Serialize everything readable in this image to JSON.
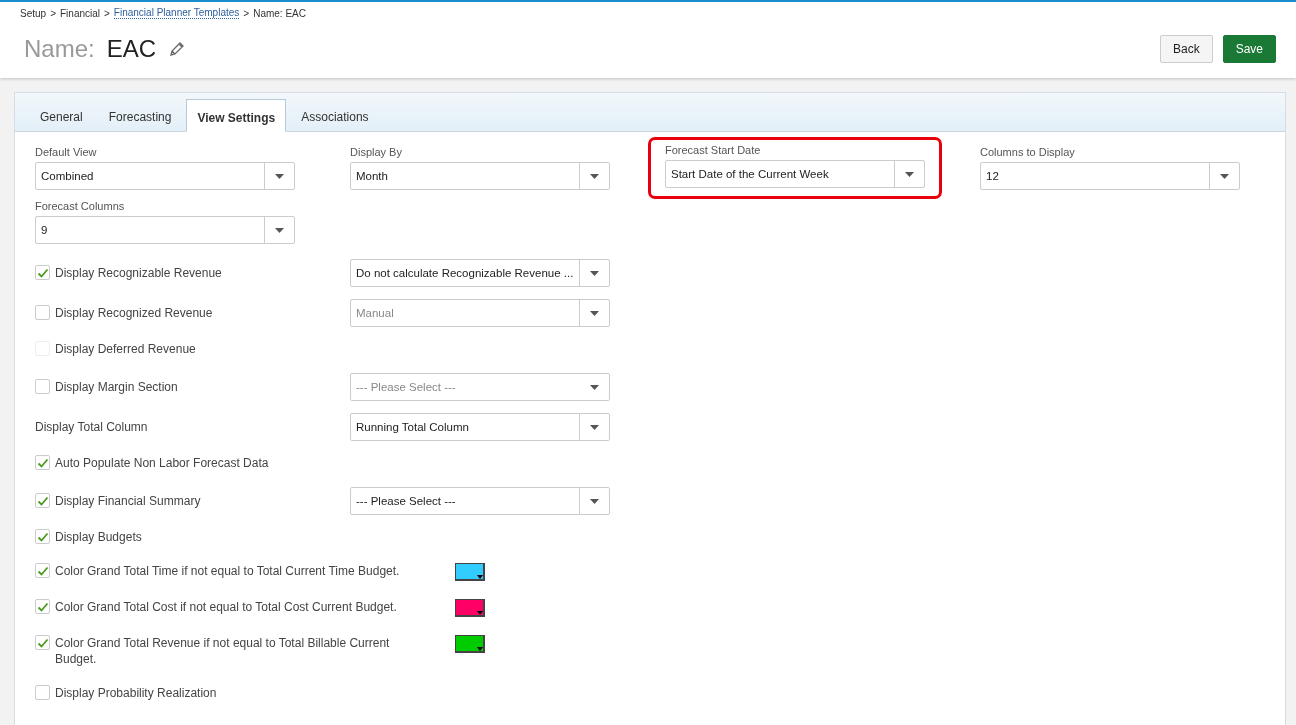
{
  "breadcrumb": [
    {
      "text": "Setup",
      "link": false
    },
    {
      "text": "Financial",
      "link": false
    },
    {
      "text": "Financial Planner Templates",
      "link": true
    },
    {
      "text": "Name: EAC",
      "link": false
    }
  ],
  "breadcrumb_separator": ">",
  "title": {
    "label": "Name:",
    "value": "EAC"
  },
  "buttons": [
    {
      "label": "Back",
      "kind": "secondary"
    },
    {
      "label": "Save",
      "kind": "primary"
    }
  ],
  "tabs": [
    {
      "label": "General",
      "selected": false
    },
    {
      "label": "Forecasting",
      "selected": false
    },
    {
      "label": "View Settings",
      "selected": true
    },
    {
      "label": "Associations",
      "selected": false
    }
  ],
  "fields": [
    {
      "label": "Default View",
      "value": "Combined",
      "highlighted": false
    },
    {
      "label": "Display By",
      "value": "Month",
      "highlighted": false
    },
    {
      "label": "Forecast Start Date",
      "value": "Start Date of the Current Week",
      "highlighted": true
    },
    {
      "label": "Columns to Display",
      "value": "12",
      "highlighted": false
    },
    {
      "label": "Forecast Columns",
      "value": "9",
      "highlighted": false
    }
  ],
  "options": [
    {
      "kind": "check",
      "label": "Display Recognizable Revenue",
      "checked": true,
      "disabled": false,
      "select": {
        "value": "Do not calculate Recognizable Revenue ...",
        "disabled": false,
        "divider": true
      }
    },
    {
      "kind": "check",
      "label": "Display Recognized Revenue",
      "checked": false,
      "disabled": false,
      "select": {
        "value": "Manual",
        "disabled": true,
        "divider": true
      }
    },
    {
      "kind": "check",
      "label": "Display Deferred Revenue",
      "checked": false,
      "disabled": true
    },
    {
      "kind": "check",
      "label": "Display Margin Section",
      "checked": false,
      "disabled": false,
      "select": {
        "value": "--- Please Select ---",
        "disabled": true,
        "divider": false
      }
    },
    {
      "kind": "label",
      "label": "Display Total Column",
      "select": {
        "value": "Running Total Column",
        "disabled": false,
        "divider": true
      }
    },
    {
      "kind": "check",
      "label": "Auto Populate Non Labor Forecast Data",
      "checked": true,
      "disabled": false
    },
    {
      "kind": "check",
      "label": "Display Financial Summary",
      "checked": true,
      "disabled": false,
      "select": {
        "value": "--- Please Select ---",
        "disabled": false,
        "divider": true
      }
    },
    {
      "kind": "check",
      "label": "Display Budgets",
      "checked": true,
      "disabled": false
    },
    {
      "kind": "color",
      "label": "Color Grand Total Time if not equal to Total Current Time Budget.",
      "checked": true,
      "disabled": false,
      "color": "#33ccff"
    },
    {
      "kind": "color",
      "label": "Color Grand Total Cost if not equal to Total Cost Current Budget.",
      "checked": true,
      "disabled": false,
      "color": "#ff0066"
    },
    {
      "kind": "color",
      "label": "Color Grand Total Revenue if not equal to Total Billable Current Budget.",
      "checked": true,
      "disabled": false,
      "color": "#00cc00"
    },
    {
      "kind": "check",
      "label": "Display Probability Realization",
      "checked": false,
      "disabled": false
    }
  ]
}
